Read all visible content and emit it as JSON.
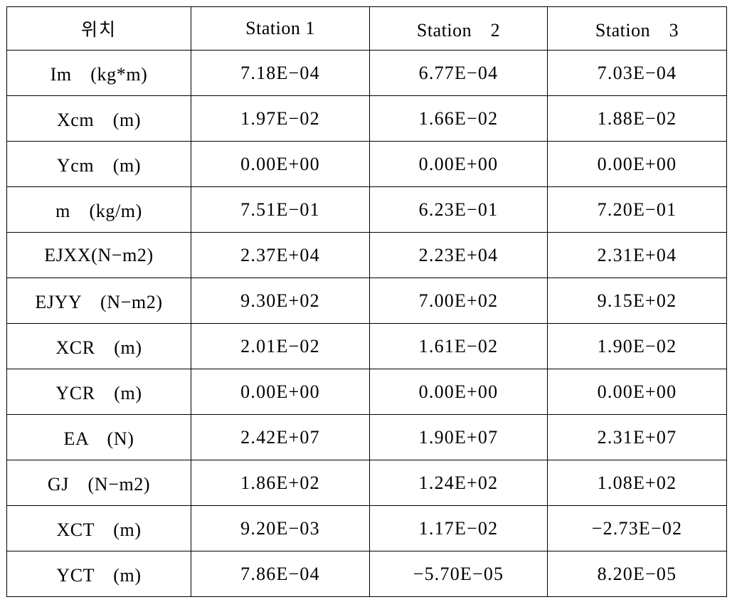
{
  "table": {
    "columns": [
      {
        "key": "label",
        "header": "위치"
      },
      {
        "key": "station1",
        "header": "Station 1"
      },
      {
        "key": "station2",
        "header": "Station　2"
      },
      {
        "key": "station3",
        "header": "Station　3"
      }
    ],
    "rows": [
      {
        "label": "Im　(kg*m)",
        "station1": "7.18E−04",
        "station2": "6.77E−04",
        "station3": "7.03E−04"
      },
      {
        "label": "Xcm　(m)",
        "station1": "1.97E−02",
        "station2": "1.66E−02",
        "station3": "1.88E−02"
      },
      {
        "label": "Ycm　(m)",
        "station1": "0.00E+00",
        "station2": "0.00E+00",
        "station3": "0.00E+00"
      },
      {
        "label": "m　(kg/m)",
        "station1": "7.51E−01",
        "station2": "6.23E−01",
        "station3": "7.20E−01"
      },
      {
        "label": "EJXX(N−m2)",
        "station1": "2.37E+04",
        "station2": "2.23E+04",
        "station3": "2.31E+04"
      },
      {
        "label": "EJYY　(N−m2)",
        "station1": "9.30E+02",
        "station2": "7.00E+02",
        "station3": "9.15E+02"
      },
      {
        "label": "XCR　(m)",
        "station1": "2.01E−02",
        "station2": "1.61E−02",
        "station3": "1.90E−02"
      },
      {
        "label": "YCR　(m)",
        "station1": "0.00E+00",
        "station2": "0.00E+00",
        "station3": "0.00E+00"
      },
      {
        "label": "EA　(N)",
        "station1": "2.42E+07",
        "station2": "1.90E+07",
        "station3": "2.31E+07"
      },
      {
        "label": "GJ　(N−m2)",
        "station1": "1.86E+02",
        "station2": "1.24E+02",
        "station3": "1.08E+02"
      },
      {
        "label": "XCT　(m)",
        "station1": "9.20E−03",
        "station2": "1.17E−02",
        "station3": "−2.73E−02"
      },
      {
        "label": "YCT　(m)",
        "station1": "7.86E−04",
        "station2": "−5.70E−05",
        "station3": "8.20E−05"
      }
    ]
  },
  "chart_data": {
    "type": "table",
    "title": "",
    "categories": [
      "Im (kg*m)",
      "Xcm (m)",
      "Ycm (m)",
      "m (kg/m)",
      "EJXX(N-m2)",
      "EJYY (N-m2)",
      "XCR (m)",
      "YCR (m)",
      "EA (N)",
      "GJ (N-m2)",
      "XCT (m)",
      "YCT (m)"
    ],
    "series": [
      {
        "name": "Station 1",
        "values": [
          0.000718,
          0.0197,
          0.0,
          0.751,
          23700.0,
          930.0,
          0.0201,
          0.0,
          24200000.0,
          186.0,
          0.0092,
          0.000786
        ]
      },
      {
        "name": "Station 2",
        "values": [
          0.000677,
          0.0166,
          0.0,
          0.623,
          22300.0,
          700.0,
          0.0161,
          0.0,
          19000000.0,
          124.0,
          0.0117,
          -5.7e-05
        ]
      },
      {
        "name": "Station 3",
        "values": [
          0.000703,
          0.0188,
          0.0,
          0.72,
          23100.0,
          915.0,
          0.019,
          0.0,
          23100000.0,
          108.0,
          -0.0273,
          8.2e-05
        ]
      }
    ]
  }
}
